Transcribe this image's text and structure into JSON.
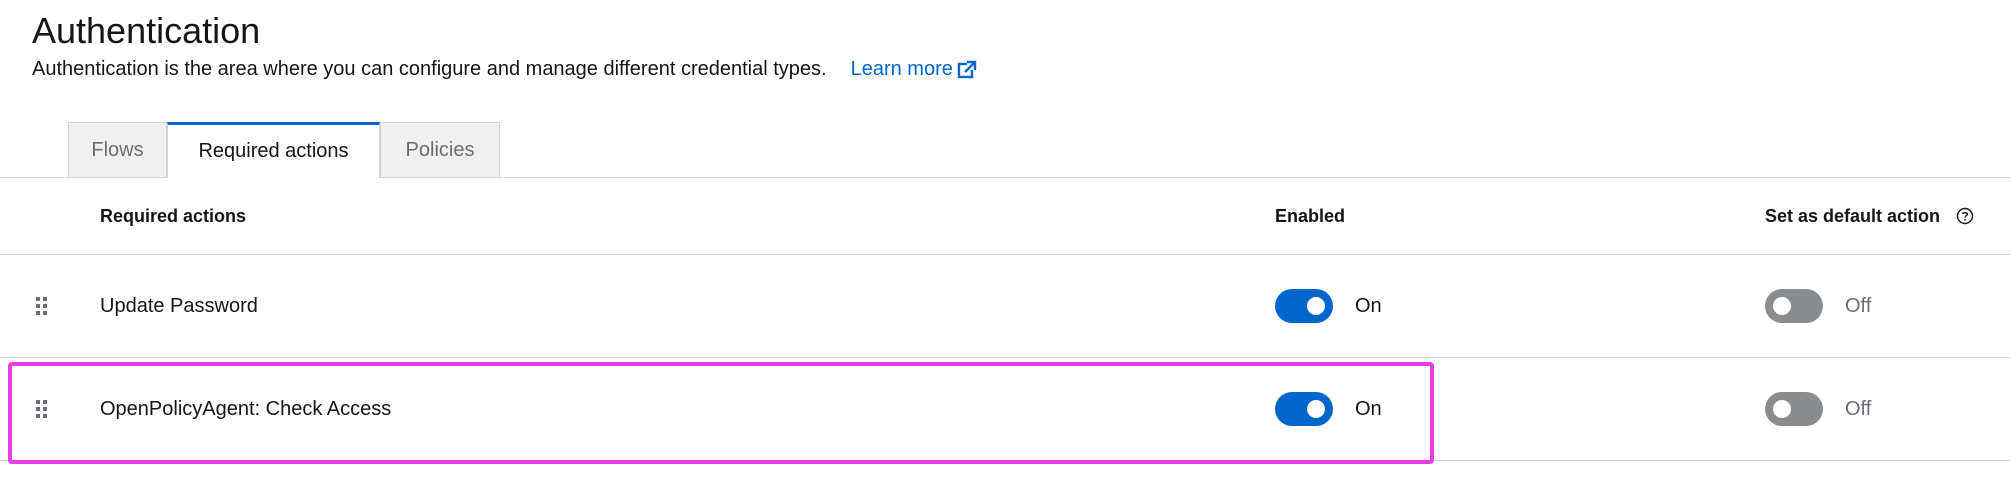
{
  "header": {
    "title": "Authentication",
    "description": "Authentication is the area where you can configure and manage different credential types.",
    "learn_more": "Learn more",
    "learn_more_icon": "external-link-icon"
  },
  "tabs": [
    {
      "label": "Flows",
      "active": false
    },
    {
      "label": "Required actions",
      "active": true
    },
    {
      "label": "Policies",
      "active": false
    }
  ],
  "table": {
    "columns": {
      "name": "Required actions",
      "enabled": "Enabled",
      "default": "Set as default action",
      "default_help_icon": "help-icon"
    },
    "rows": [
      {
        "name": "Update Password",
        "enabled": true,
        "enabled_label": "On",
        "default": false,
        "default_label": "Off"
      },
      {
        "name": "OpenPolicyAgent: Check Access",
        "enabled": true,
        "enabled_label": "On",
        "default": false,
        "default_label": "Off"
      }
    ]
  },
  "colors": {
    "accent": "#0066cc",
    "toggle_off": "#8a8d90",
    "highlight": "#e83de8"
  }
}
